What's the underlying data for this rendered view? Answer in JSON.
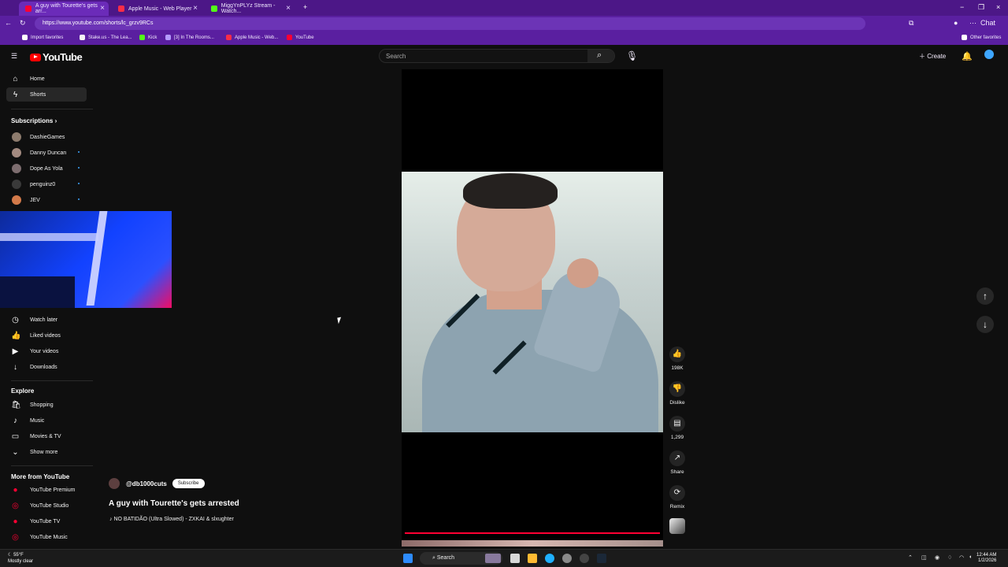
{
  "browser": {
    "tabs": [
      {
        "title": "A guy with Tourette's gets arr...",
        "active": true,
        "favicon_color": "#ff0033"
      },
      {
        "title": "Apple Music - Web Player",
        "active": false,
        "favicon_color": "#fa2d48"
      },
      {
        "title": "MiggYnPLYz Stream - Watch...",
        "active": false,
        "favicon_color": "#53fc18"
      }
    ],
    "url": "https://www.youtube.com/shorts/lc_grzv9RCs",
    "bookmarks": [
      "Import favorites",
      "Stake.us - The Lea...",
      "Kick",
      "[3] In The Rooms...",
      "Apple Music - Web...",
      "YouTube"
    ],
    "other_favorites": "Other favorites",
    "chat": "Chat"
  },
  "youtube": {
    "logo": "YouTube",
    "search_placeholder": "Search",
    "create": "Create"
  },
  "sidebar": {
    "items": [
      {
        "label": "Home",
        "icon": "home-icon"
      },
      {
        "label": "Shorts",
        "icon": "shorts-icon"
      }
    ],
    "subscriptions_title": "Subscriptions",
    "subscriptions": [
      {
        "label": "DashieGames",
        "live": false,
        "color": "#8d7b6d"
      },
      {
        "label": "Danny Duncan",
        "live": true,
        "color": "#a38a80"
      },
      {
        "label": "Dope As Yola",
        "live": true,
        "color": "#7d6d6f"
      },
      {
        "label": "penguinz0",
        "live": true,
        "color": "#393939"
      },
      {
        "label": "JEV",
        "live": true,
        "color": "#d37a4a"
      }
    ],
    "library": [
      {
        "label": "Watch later",
        "icon": "watch-later-icon"
      },
      {
        "label": "Liked videos",
        "icon": "liked-videos-icon"
      },
      {
        "label": "Your videos",
        "icon": "your-videos-icon"
      },
      {
        "label": "Downloads",
        "icon": "downloads-icon"
      }
    ],
    "explore_title": "Explore",
    "explore": [
      {
        "label": "Shopping",
        "icon": "shopping-icon"
      },
      {
        "label": "Music",
        "icon": "music-icon"
      },
      {
        "label": "Movies & TV",
        "icon": "movies-icon"
      },
      {
        "label": "Show more",
        "icon": "chevron-down-icon"
      }
    ],
    "more_title": "More from YouTube",
    "more": [
      {
        "label": "YouTube Premium",
        "icon": "youtube-premium-icon"
      },
      {
        "label": "YouTube Studio",
        "icon": "youtube-studio-icon"
      },
      {
        "label": "YouTube TV",
        "icon": "youtube-tv-icon"
      },
      {
        "label": "YouTube Music",
        "icon": "youtube-music-icon"
      }
    ]
  },
  "short": {
    "channel": "@db1000cuts",
    "subscribe": "Subscribe",
    "title": "A guy with Tourette's gets arrested",
    "music": "NO BATIDÃO (Ultra Slowed) - ZXKAI & slxughter",
    "likes": "198K",
    "dislike": "Dislike",
    "comments": "1,299",
    "share": "Share",
    "remix": "Remix"
  },
  "taskbar": {
    "weather_temp": "55°F",
    "weather_desc": "Mostly clear",
    "search": "Search",
    "time": "12:44 AM",
    "date": "1/2/2026"
  }
}
